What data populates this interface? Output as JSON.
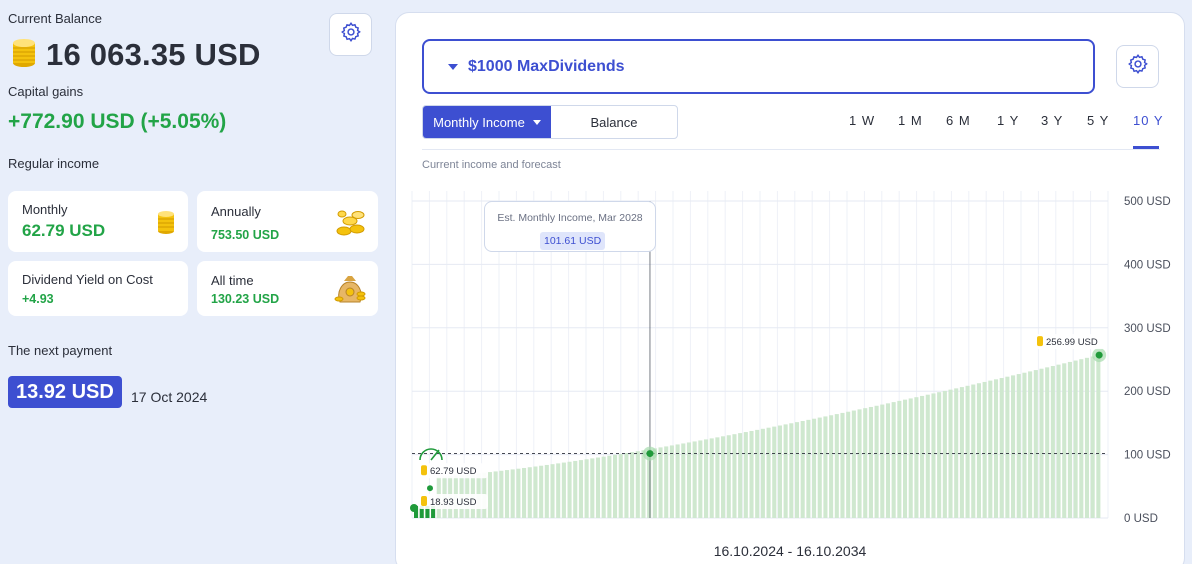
{
  "summary": {
    "balance_label": "Current Balance",
    "balance_value": "16 063.35 USD",
    "gains_label": "Capital gains",
    "gains_value": "+772.90 USD (+5.05%)",
    "regular_label": "Regular income"
  },
  "cards": {
    "monthly": {
      "label": "Monthly",
      "value": "62.79 USD"
    },
    "annually": {
      "label": "Annually",
      "value": "753.50 USD"
    },
    "yield": {
      "label": "Dividend Yield on Cost",
      "value": "+4.93"
    },
    "alltime": {
      "label": "All time",
      "value": "130.23 USD"
    }
  },
  "payment": {
    "label": "The next payment",
    "amount": "13.92 USD",
    "date": "17 Oct 2024"
  },
  "portfolio": {
    "selected": "$1000 MaxDividends"
  },
  "toggle": {
    "active": "Monthly Income",
    "inactive": "Balance"
  },
  "ranges": [
    "1 W",
    "1 M",
    "6 M",
    "1 Y",
    "3 Y",
    "5 Y",
    "10 Y"
  ],
  "active_range": "10 Y",
  "chart_subtitle": "Current income and forecast",
  "date_range": "16.10.2024 - 16.10.2034",
  "tooltip": {
    "title": "Est. Monthly Income, Mar 2028",
    "value": "101.61 USD"
  },
  "colors": {
    "accent": "#3d4fd1",
    "positive": "#22a447",
    "bar": "#cfe8cf",
    "bar_actual": "#1f9a3a"
  },
  "chart_data": {
    "type": "bar",
    "title": "",
    "xlabel": "",
    "ylabel": "",
    "y_ticks": [
      "500 USD",
      "400 USD",
      "300 USD",
      "200 USD",
      "100 USD",
      "0 USD"
    ],
    "ylim": [
      0,
      500
    ],
    "x_range": [
      "16.10.2024",
      "16.10.2034"
    ],
    "bar_count": 121,
    "actual_bar_count": 4,
    "start_value": 62.79,
    "end_value": 256.99,
    "reference_line": 101.61,
    "reference_index": 41,
    "annotations": [
      {
        "label": "256.99 USD",
        "value": 256.99
      },
      {
        "label": "62.79 USD",
        "value": 62.79
      },
      {
        "label": "18.93 USD",
        "value": 18.93
      }
    ],
    "grid": true,
    "legend": "none"
  }
}
